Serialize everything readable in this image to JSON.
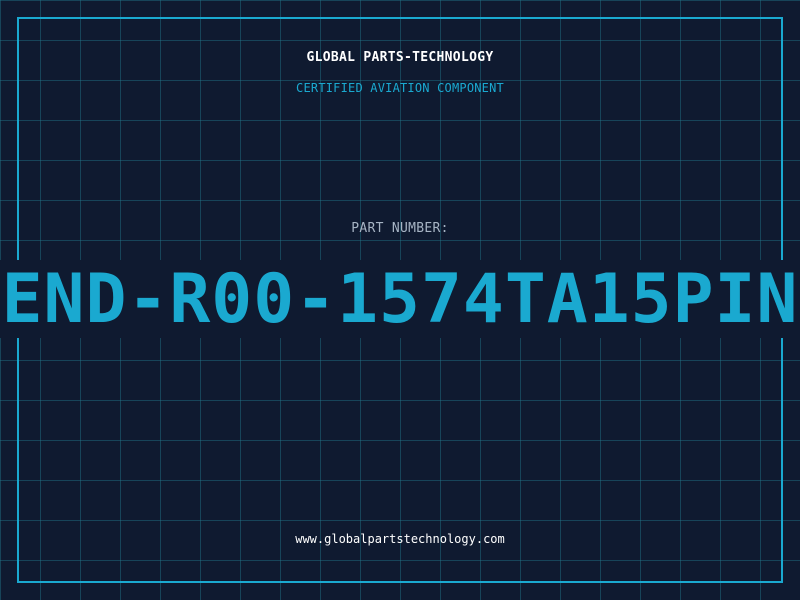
{
  "header": {
    "brand": "GLOBAL PARTS-TECHNOLOGY",
    "subtitle": "CERTIFIED AVIATION COMPONENT"
  },
  "part": {
    "label": "PART NUMBER:",
    "number": "END-R00-1574TA15PIN"
  },
  "footer": {
    "url": "www.globalpartstechnology.com"
  },
  "colors": {
    "background": "#0f1a30",
    "accent": "#1aa9d0",
    "grid": "#21788c",
    "text": "#ffffff",
    "muted": "#a7b4c4"
  }
}
